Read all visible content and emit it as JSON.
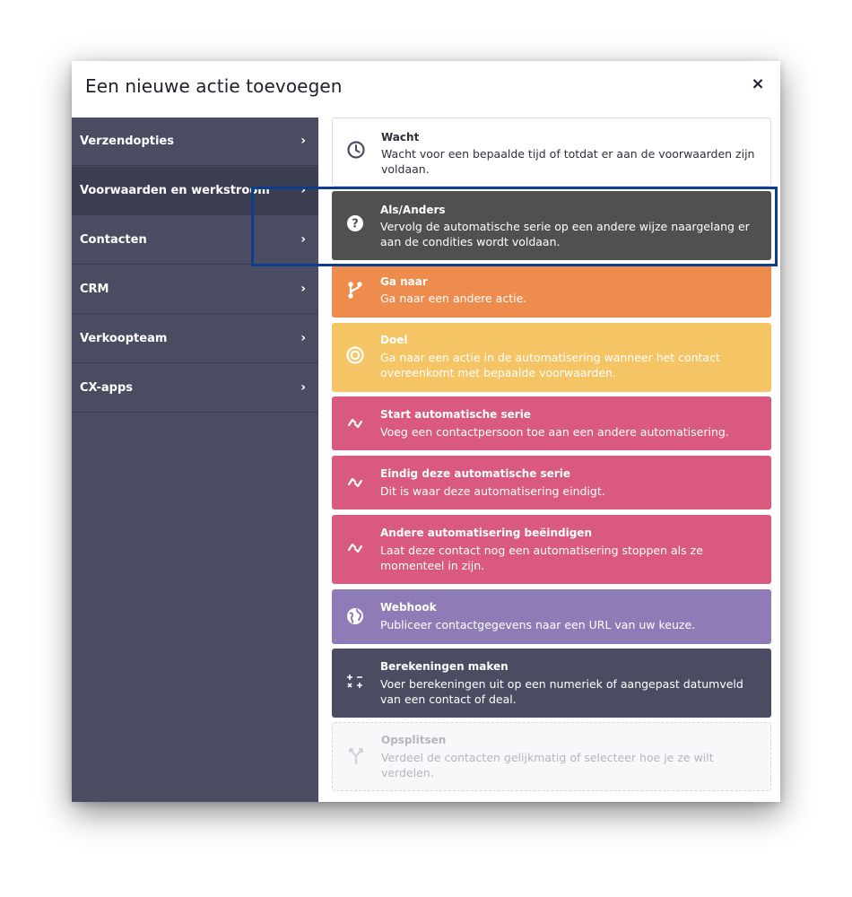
{
  "modal": {
    "title": "Een nieuwe actie toevoegen",
    "close_label": "×"
  },
  "sidebar": {
    "items": [
      {
        "label": "Verzendopties",
        "chevron": "›",
        "active": false
      },
      {
        "label": "Voorwaarden en werkstroom",
        "chevron": "›",
        "active": true
      },
      {
        "label": "Contacten",
        "chevron": "›",
        "active": false
      },
      {
        "label": "CRM",
        "chevron": "›",
        "active": false
      },
      {
        "label": "Verkoopteam",
        "chevron": "›",
        "active": false
      },
      {
        "label": "CX-apps",
        "chevron": "›",
        "active": false
      }
    ]
  },
  "actions": [
    {
      "title": "Wacht",
      "desc": "Wacht voor een bepaalde tijd of totdat er aan de voorwaarden zijn voldaan.",
      "icon": "clock-icon",
      "color": "#ffffff"
    },
    {
      "title": "Als/Anders",
      "desc": "Vervolg de automatische serie op een andere wijze naargelang er aan de condities wordt voldaan.",
      "icon": "question-icon",
      "color": "#505050",
      "highlighted": true
    },
    {
      "title": "Ga naar",
      "desc": "Ga naar een andere actie.",
      "icon": "branch-icon",
      "color": "#ee8c4e"
    },
    {
      "title": "Doel",
      "desc": "Ga naar een actie in de automatisering wanneer het contact overeenkomt met bepaalde voorwaarden.",
      "icon": "target-icon",
      "color": "#f5c465"
    },
    {
      "title": "Start automatische serie",
      "desc": "Voeg een contactpersoon toe aan een andere automatisering.",
      "icon": "sync-icon",
      "color": "#d95a7e"
    },
    {
      "title": "Eindig deze automatische serie",
      "desc": "Dit is waar deze automatisering eindigt.",
      "icon": "sync-icon",
      "color": "#d95a7e"
    },
    {
      "title": "Andere automatisering beëindigen",
      "desc": "Laat deze contact nog een automatisering stoppen als ze momenteel in zijn.",
      "icon": "sync-icon",
      "color": "#d95a7e"
    },
    {
      "title": "Webhook",
      "desc": "Publiceer contactgegevens naar een URL van uw keuze.",
      "icon": "globe-icon",
      "color": "#8f7cb6"
    },
    {
      "title": "Berekeningen maken",
      "desc": "Voer berekeningen uit op een numeriek of aangepast datumveld van een contact of deal.",
      "icon": "calculator-icon",
      "color": "#4a4d61"
    },
    {
      "title": "Opsplitsen",
      "desc": "Verdeel de contacten gelijkmatig of selecteer hoe je ze wilt verdelen.",
      "icon": "split-icon",
      "color": "#f8f8fa",
      "disabled": true
    }
  ]
}
